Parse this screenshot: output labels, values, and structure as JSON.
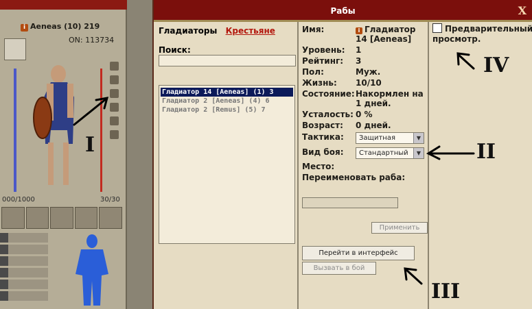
{
  "modal": {
    "title": "Рабы",
    "close": "X",
    "tabs": {
      "gladiators": "Гладиаторы",
      "peasants": "Крестьяне"
    },
    "search": {
      "label": "Поиск:",
      "value": ""
    },
    "slaves": [
      "Гладиатор 14 [Aeneas] (1) 3",
      "Гладиатор 2 [Aeneas] (4) 6",
      "Гладиатор 2 [Remus] (5) 7"
    ],
    "selected_index": 0,
    "details": {
      "name_label": "Имя:",
      "name_value": "Гладиатор 14 [Aeneas]",
      "level_label": "Уровень:",
      "level_value": "1",
      "rating_label": "Рейтинг:",
      "rating_value": "3",
      "sex_label": "Пол:",
      "sex_value": "Муж.",
      "life_label": "Жизнь:",
      "life_value": "10/10",
      "state_label": "Состояние:",
      "state_value": "Накормлен на 1 дней.",
      "fatigue_label": "Усталость:",
      "fatigue_value": "0 %",
      "age_label": "Возраст:",
      "age_value": "0 дней.",
      "tactics_label": "Тактика:",
      "tactics_value": "Защитная",
      "fight_label": "Вид боя:",
      "fight_value": "Стандартный",
      "place_label": "Место:",
      "rename_label": "Переименовать раба:",
      "rename_value": ""
    },
    "buttons": {
      "apply": "Применить",
      "goto_interface": "Перейти в интерфейс",
      "challenge": "Вызвать в бой"
    },
    "preview": {
      "label": "Предварительный просмотр.",
      "checked": false
    }
  },
  "left": {
    "player": "Aeneas (10) 219",
    "money": "ON: 113734",
    "hp_left": "000/1000",
    "hp_right": "30/30"
  },
  "annotations": [
    "I",
    "II",
    "III",
    "IV"
  ]
}
